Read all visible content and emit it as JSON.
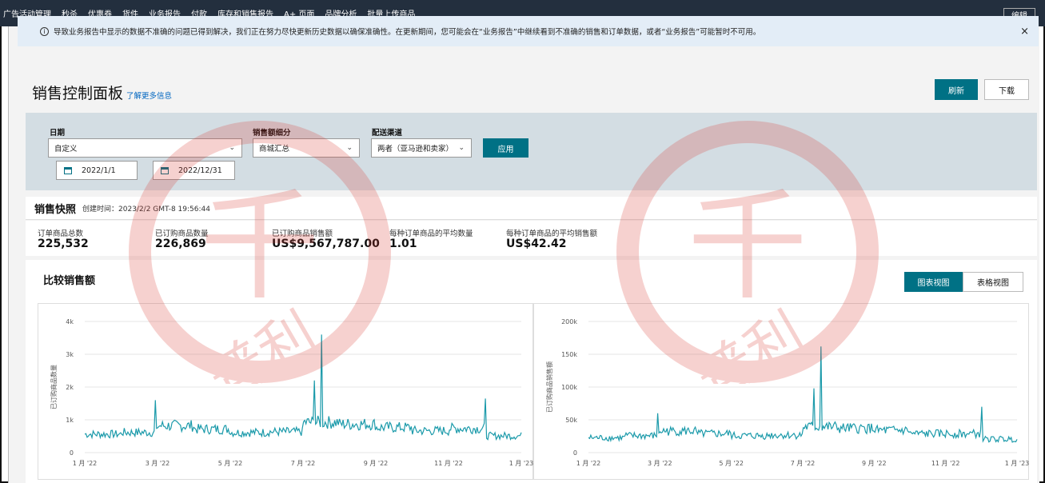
{
  "topnav": {
    "items": [
      "广告活动管理",
      "秒杀",
      "优惠券",
      "货件",
      "业务报告",
      "付款",
      "库存和销售报告",
      "A+ 页面",
      "品牌分析",
      "批量上传商品"
    ],
    "edit_label": "编辑"
  },
  "notice": {
    "icon": "info-icon",
    "text": "导致业务报告中显示的数据不准确的问题已得到解决，我们正在努力尽快更新历史数据以确保准确性。在更新期间，您可能会在“业务报告”中继续看到不准确的销售和订单数据，或者“业务报告”可能暂时不可用。",
    "close": "×"
  },
  "header": {
    "title": "销售控制面板",
    "learn_more": "了解更多信息",
    "refresh_label": "刷新",
    "download_label": "下载"
  },
  "filters": {
    "date_label": "日期",
    "date_value": "自定义",
    "start_date": "2022/1/1",
    "end_date": "2022/12/31",
    "breakdown_label": "销售额细分",
    "breakdown_value": "商城汇总",
    "channel_label": "配送渠道",
    "channel_value": "两者（亚马逊和卖家）",
    "apply_label": "应用"
  },
  "snapshot": {
    "title": "销售快照",
    "created": "创建时间：2023/2/2 GMT-8 19:56:44",
    "metrics": [
      {
        "label": "订单商品总数",
        "value": "225,532"
      },
      {
        "label": "已订购商品数量",
        "value": "226,869"
      },
      {
        "label": "已订购商品销售额",
        "value": "US$9,567,787.00"
      },
      {
        "label": "每种订单商品的平均数量",
        "value": "1.01"
      },
      {
        "label": "每种订单商品的平均销售额",
        "value": "US$42.42"
      }
    ]
  },
  "compare": {
    "title": "比较销售额",
    "chart_view_label": "图表视图",
    "table_view_label": "表格视图"
  },
  "colors": {
    "nav_bg": "#232f3e",
    "accent": "#007185",
    "notice_bg": "#e3edf7",
    "filter_bg": "#d3dde3",
    "line": "#1b9aaa",
    "watermark": "#d9342b"
  },
  "chart_data": [
    {
      "type": "line",
      "ylabel": "已订购商品数量",
      "x_ticks": [
        "1 月 '22",
        "3 月 '22",
        "5 月 '22",
        "7 月 '22",
        "9 月 '22",
        "11 月 '22",
        "1 月 '23"
      ],
      "y_ticks": [
        "0",
        "1k",
        "2k",
        "3k",
        "4k"
      ],
      "ylim": [
        0,
        4000
      ],
      "grid": true,
      "x": [
        "2022-01",
        "2022-02",
        "2022-03",
        "2022-04",
        "2022-05",
        "2022-06",
        "2022-07",
        "2022-08",
        "2022-09",
        "2022-10",
        "2022-11",
        "2022-12"
      ],
      "series": [
        {
          "values": [
            550,
            600,
            800,
            700,
            600,
            620,
            900,
            850,
            750,
            650,
            720,
            500
          ]
        }
      ],
      "peaks": [
        {
          "date": "2022-03-01",
          "value": 1600
        },
        {
          "date": "2022-07-12",
          "value": 2200
        },
        {
          "date": "2022-07-18",
          "value": 3600
        },
        {
          "date": "2022-12-02",
          "value": 1650
        }
      ]
    },
    {
      "type": "line",
      "ylabel": "已订购商品销售额",
      "x_ticks": [
        "1 月 '22",
        "3 月 '22",
        "5 月 '22",
        "7 月 '22",
        "9 月 '22",
        "11 月 '22",
        "1 月 '23"
      ],
      "y_ticks": [
        "0",
        "50k",
        "100k",
        "150k",
        "200k"
      ],
      "ylim": [
        0,
        200000
      ],
      "grid": true,
      "x": [
        "2022-01",
        "2022-02",
        "2022-03",
        "2022-04",
        "2022-05",
        "2022-06",
        "2022-07",
        "2022-08",
        "2022-09",
        "2022-10",
        "2022-11",
        "2022-12"
      ],
      "series": [
        {
          "values": [
            22000,
            25000,
            32000,
            28000,
            25000,
            26000,
            38000,
            36000,
            33000,
            28000,
            28000,
            20000
          ]
        }
      ],
      "peaks": [
        {
          "date": "2022-03-01",
          "value": 60000
        },
        {
          "date": "2022-07-12",
          "value": 98000
        },
        {
          "date": "2022-07-18",
          "value": 162000
        },
        {
          "date": "2022-12-02",
          "value": 70000
        }
      ]
    }
  ],
  "watermark": {
    "seal_text": "普利",
    "center_glyph": "千"
  }
}
